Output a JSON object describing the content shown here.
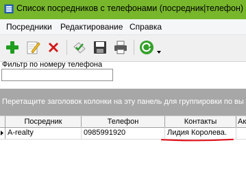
{
  "window": {
    "title": "Список посредников с телефонами (посредник|телефон)",
    "titlebar_color": "#78b72c"
  },
  "menu": {
    "items": [
      {
        "label": "Посредники"
      },
      {
        "label": "Редактирование"
      },
      {
        "label": "Справка"
      }
    ]
  },
  "toolbar": {
    "buttons": [
      {
        "icon": "plus-icon",
        "color": "#1f9e1f"
      },
      {
        "icon": "edit-icon"
      },
      {
        "icon": "delete-icon",
        "color": "#d41616"
      },
      {
        "icon": "check-icon"
      },
      {
        "icon": "save-icon"
      },
      {
        "icon": "print-icon"
      },
      {
        "icon": "refresh-icon",
        "color": "#34a12a"
      }
    ]
  },
  "filter": {
    "label": "Фильтр по номеру телефона",
    "value": ""
  },
  "group_panel": {
    "text": "Перетащите заголовок колонки на эту панель для группировки по вы"
  },
  "grid": {
    "columns": [
      "Посредник",
      "Телефон",
      "Контакты",
      "Ак"
    ],
    "rows": [
      {
        "broker": "A-realty",
        "phone": "0985991920",
        "contacts": "Лидия Королева.",
        "extra": ""
      }
    ],
    "highlight_color": "#e0141e"
  }
}
